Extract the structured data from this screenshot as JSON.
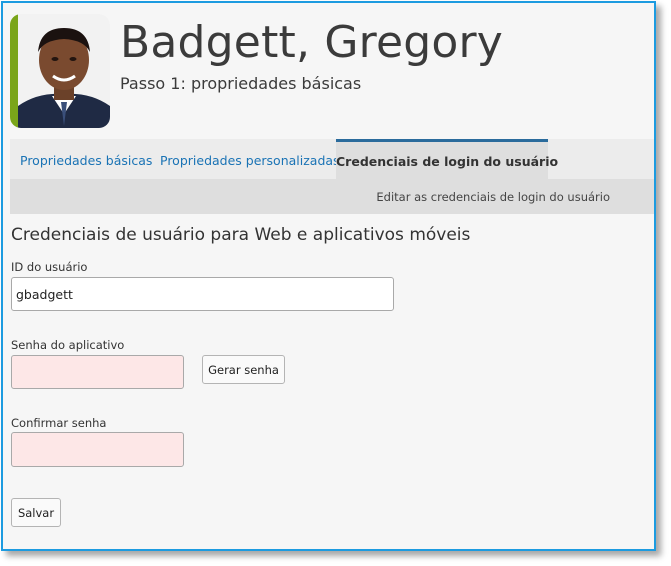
{
  "user": {
    "name": "Badgett, Gregory",
    "step": "Passo 1: propriedades básicas"
  },
  "tabs": [
    {
      "label": "Propriedades básicas",
      "active": false
    },
    {
      "label": "Propriedades personalizadas",
      "active": false
    },
    {
      "label": "Credenciais de login do usuário",
      "active": true
    }
  ],
  "subbar": {
    "label": "Editar as credenciais de login do usuário"
  },
  "form": {
    "title": "Credenciais de usuário para Web e aplicativos móveis",
    "user_id_label": "ID do usuário",
    "user_id_value": "gbadgett",
    "password_label": "Senha do aplicativo",
    "password_value": "",
    "generate_label": "Gerar senha",
    "confirm_label": "Confirmar senha",
    "confirm_value": "",
    "save_label": "Salvar"
  },
  "colors": {
    "frame_border": "#1c9be0",
    "avatar_stripe": "#7aa51a",
    "tab_link": "#1a73b5",
    "active_tab_border": "#2a6b9c",
    "invalid_field": "#fde7e7"
  }
}
